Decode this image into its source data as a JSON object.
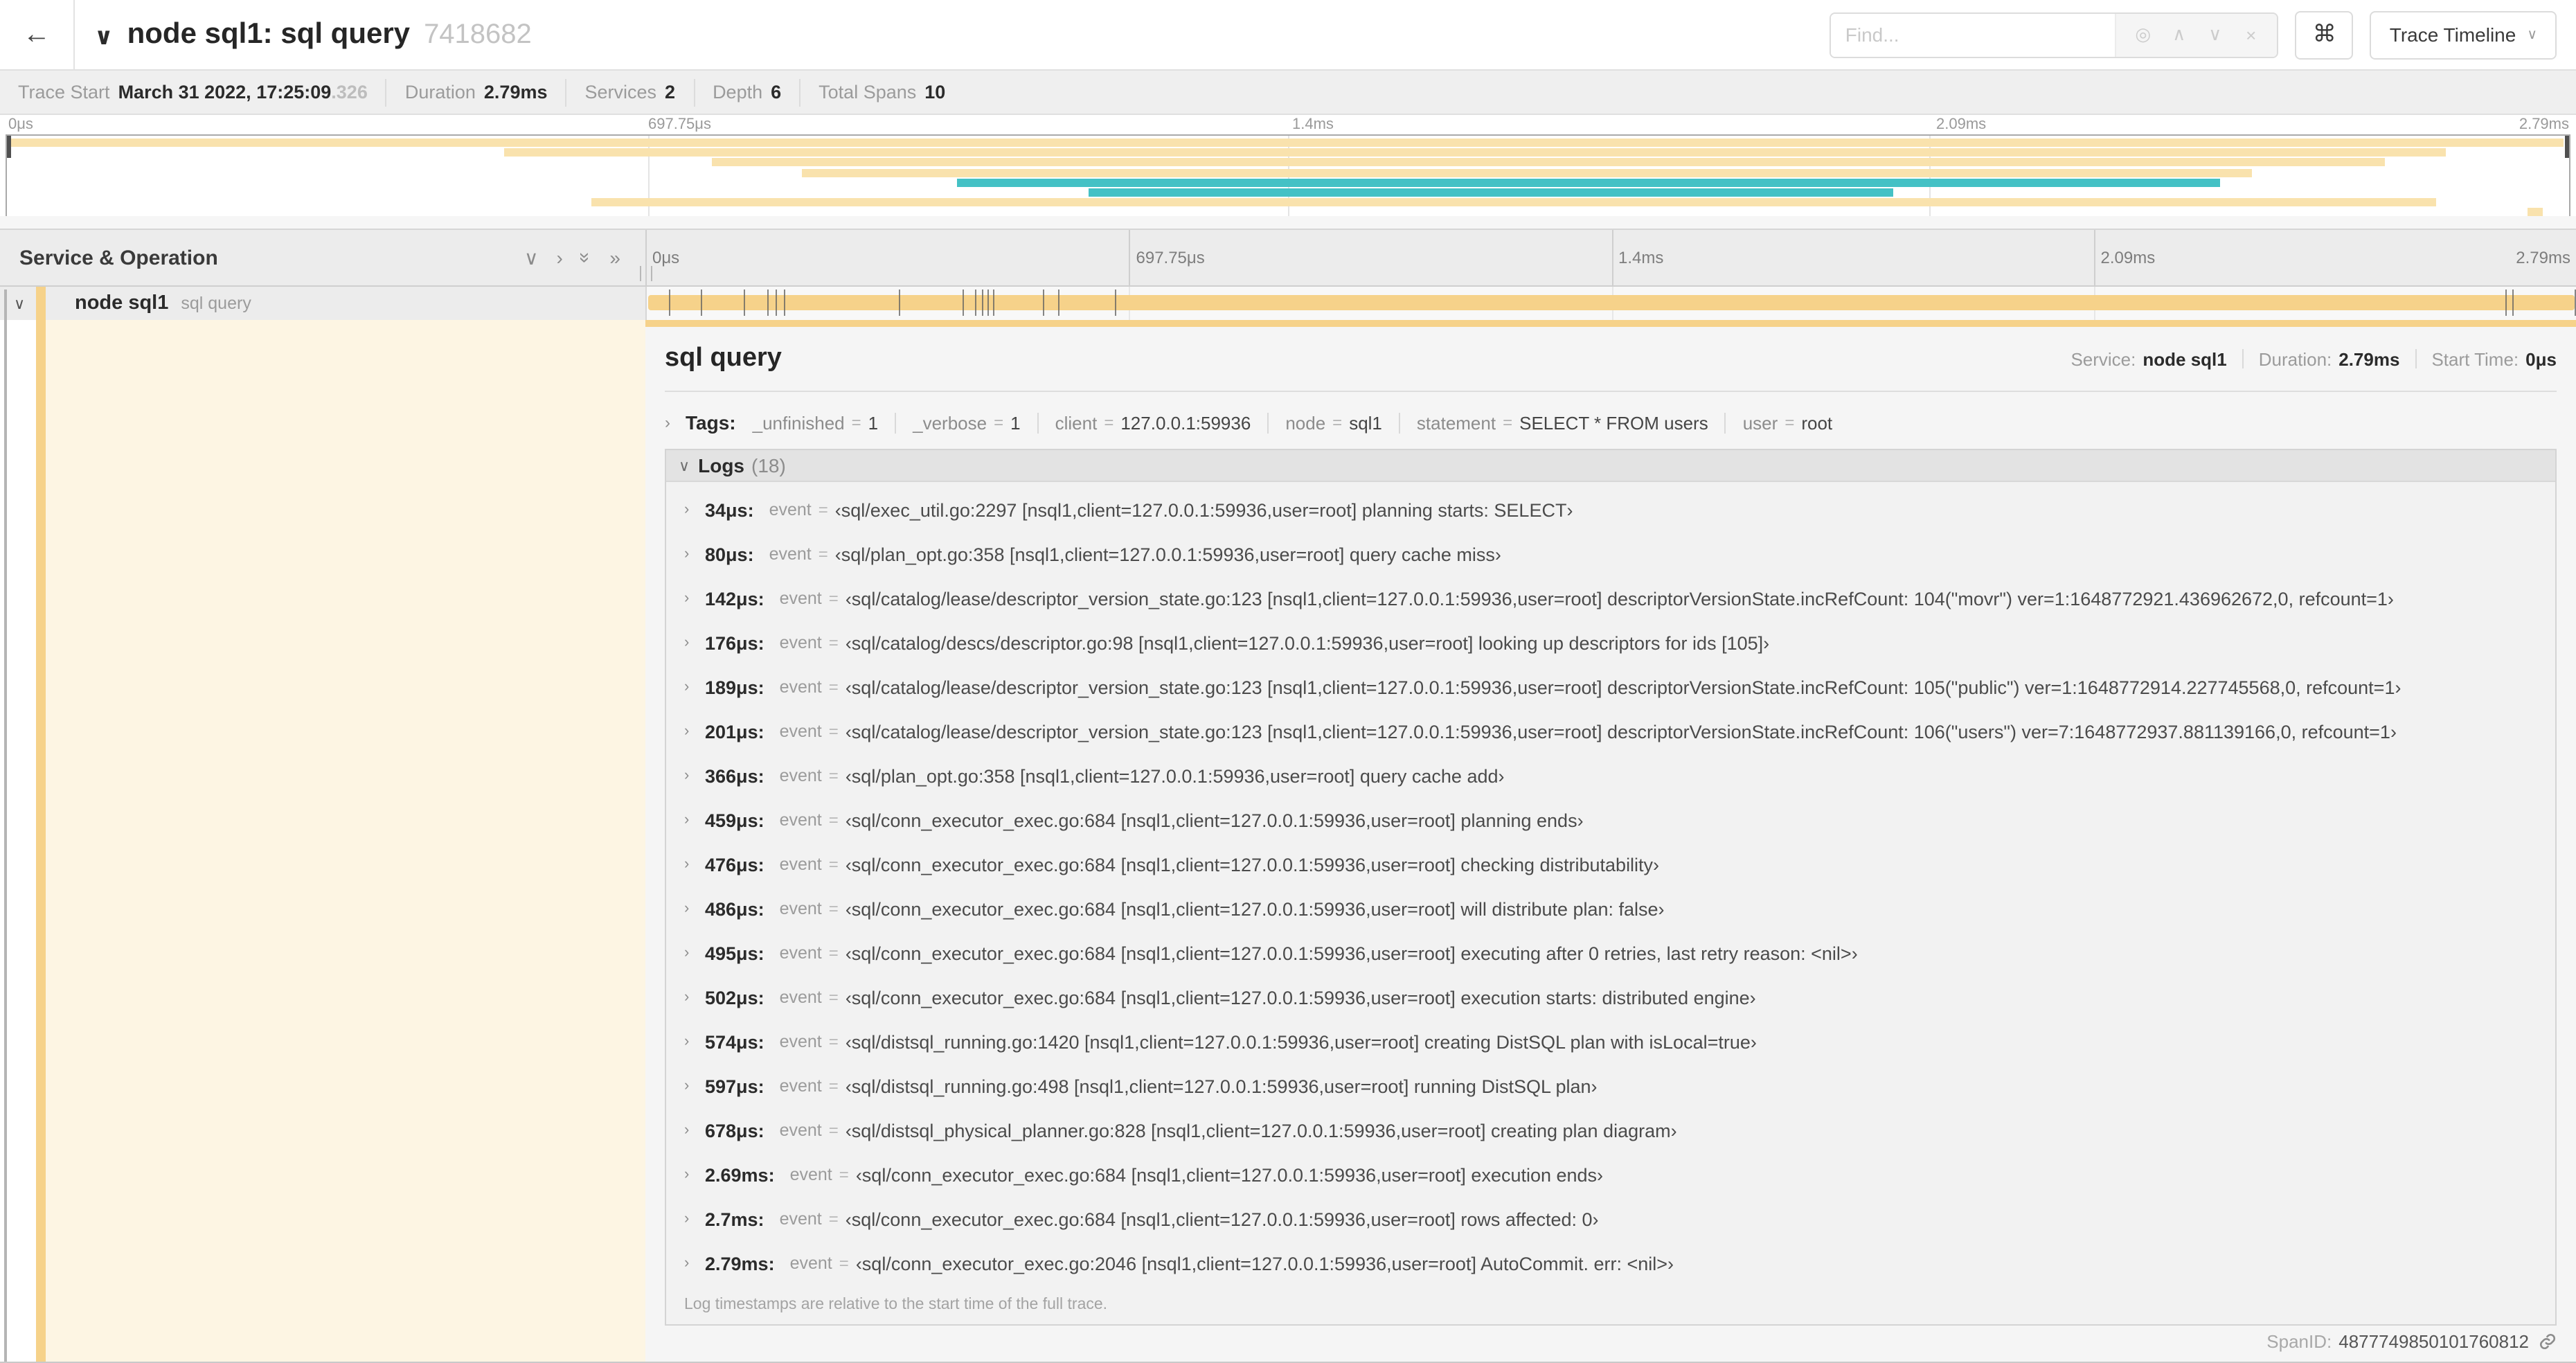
{
  "icons": {
    "back_arrow": "←",
    "chevron_down": "∨",
    "chevron_right": "›",
    "double_chevron": "»",
    "target": "◎",
    "up": "∧",
    "down": "∨",
    "close": "×",
    "command": "⌘",
    "caret_down": "∨"
  },
  "header": {
    "title": "node sql1: sql query",
    "trace_id": "7418682",
    "find_placeholder": "Find...",
    "view_button": "Trace Timeline"
  },
  "trace_info": [
    {
      "label": "Trace Start",
      "value": "March 31 2022, 17:25:09",
      "suffix": ".326"
    },
    {
      "label": "Duration",
      "value": "2.79ms"
    },
    {
      "label": "Services",
      "value": "2"
    },
    {
      "label": "Depth",
      "value": "6"
    },
    {
      "label": "Total Spans",
      "value": "10"
    }
  ],
  "timeline": {
    "ticks": [
      {
        "label": "0μs",
        "pct": 0
      },
      {
        "label": "697.75μs",
        "pct": 25
      },
      {
        "label": "1.4ms",
        "pct": 50
      },
      {
        "label": "2.09ms",
        "pct": 75
      },
      {
        "label": "2.79ms",
        "pct": 100
      }
    ],
    "total_us": 2790
  },
  "minimap": {
    "rows": [
      {
        "start": 0,
        "end": 99.8,
        "color": "yellow"
      },
      {
        "start": 19.4,
        "end": 95.2,
        "color": "yellow"
      },
      {
        "start": 27.5,
        "end": 92.8,
        "color": "yellow"
      },
      {
        "start": 31.0,
        "end": 87.6,
        "color": "yellow"
      },
      {
        "start": 37.1,
        "end": 86.4,
        "color": "teal"
      },
      {
        "start": 42.2,
        "end": 73.6,
        "color": "teal"
      },
      {
        "start": 22.8,
        "end": 94.8,
        "color": "yellow"
      },
      {
        "start": 98.4,
        "end": 99.0,
        "color": "yellow"
      }
    ]
  },
  "left_panel": {
    "title": "Service & Operation"
  },
  "span_row": {
    "service": "node sql1",
    "operation": "sql query"
  },
  "detail": {
    "title": "sql query",
    "stats": [
      {
        "label": "Service:",
        "value": "node sql1"
      },
      {
        "label": "Duration:",
        "value": "2.79ms"
      },
      {
        "label": "Start Time:",
        "value": "0μs"
      }
    ],
    "tags_label": "Tags:",
    "tags": [
      {
        "key": "_unfinished",
        "value": "1"
      },
      {
        "key": "_verbose",
        "value": "1"
      },
      {
        "key": "client",
        "value": "127.0.0.1:59936"
      },
      {
        "key": "node",
        "value": "sql1"
      },
      {
        "key": "statement",
        "value": "SELECT * FROM users"
      },
      {
        "key": "user",
        "value": "root"
      }
    ],
    "logs_label": "Logs",
    "logs_count": "(18)",
    "logs_key": "event",
    "logs": [
      {
        "time": "34μs:",
        "t_us": 34,
        "value": "‹sql/exec_util.go:2297 [nsql1,client=127.0.0.1:59936,user=root] planning starts: SELECT›"
      },
      {
        "time": "80μs:",
        "t_us": 80,
        "value": "‹sql/plan_opt.go:358 [nsql1,client=127.0.0.1:59936,user=root] query cache miss›"
      },
      {
        "time": "142μs:",
        "t_us": 142,
        "value": "‹sql/catalog/lease/descriptor_version_state.go:123 [nsql1,client=127.0.0.1:59936,user=root] descriptorVersionState.incRefCount: 104(\"movr\") ver=1:1648772921.436962672,0, refcount=1›"
      },
      {
        "time": "176μs:",
        "t_us": 176,
        "value": "‹sql/catalog/descs/descriptor.go:98 [nsql1,client=127.0.0.1:59936,user=root] looking up descriptors for ids [105]›"
      },
      {
        "time": "189μs:",
        "t_us": 189,
        "value": "‹sql/catalog/lease/descriptor_version_state.go:123 [nsql1,client=127.0.0.1:59936,user=root] descriptorVersionState.incRefCount: 105(\"public\") ver=1:1648772914.227745568,0, refcount=1›"
      },
      {
        "time": "201μs:",
        "t_us": 201,
        "value": "‹sql/catalog/lease/descriptor_version_state.go:123 [nsql1,client=127.0.0.1:59936,user=root] descriptorVersionState.incRefCount: 106(\"users\") ver=7:1648772937.881139166,0, refcount=1›"
      },
      {
        "time": "366μs:",
        "t_us": 366,
        "value": "‹sql/plan_opt.go:358 [nsql1,client=127.0.0.1:59936,user=root] query cache add›"
      },
      {
        "time": "459μs:",
        "t_us": 459,
        "value": "‹sql/conn_executor_exec.go:684 [nsql1,client=127.0.0.1:59936,user=root] planning ends›"
      },
      {
        "time": "476μs:",
        "t_us": 476,
        "value": "‹sql/conn_executor_exec.go:684 [nsql1,client=127.0.0.1:59936,user=root] checking distributability›"
      },
      {
        "time": "486μs:",
        "t_us": 486,
        "value": "‹sql/conn_executor_exec.go:684 [nsql1,client=127.0.0.1:59936,user=root] will distribute plan: false›"
      },
      {
        "time": "495μs:",
        "t_us": 495,
        "value": "‹sql/conn_executor_exec.go:684 [nsql1,client=127.0.0.1:59936,user=root] executing after 0 retries, last retry reason: <nil>›"
      },
      {
        "time": "502μs:",
        "t_us": 502,
        "value": "‹sql/conn_executor_exec.go:684 [nsql1,client=127.0.0.1:59936,user=root] execution starts: distributed engine›"
      },
      {
        "time": "574μs:",
        "t_us": 574,
        "value": "‹sql/distsql_running.go:1420 [nsql1,client=127.0.0.1:59936,user=root] creating DistSQL plan with isLocal=true›"
      },
      {
        "time": "597μs:",
        "t_us": 597,
        "value": "‹sql/distsql_running.go:498 [nsql1,client=127.0.0.1:59936,user=root] running DistSQL plan›"
      },
      {
        "time": "678μs:",
        "t_us": 678,
        "value": "‹sql/distsql_physical_planner.go:828 [nsql1,client=127.0.0.1:59936,user=root] creating plan diagram›"
      },
      {
        "time": "2.69ms:",
        "t_us": 2690,
        "value": "‹sql/conn_executor_exec.go:684 [nsql1,client=127.0.0.1:59936,user=root] execution ends›"
      },
      {
        "time": "2.7ms:",
        "t_us": 2700,
        "value": "‹sql/conn_executor_exec.go:684 [nsql1,client=127.0.0.1:59936,user=root] rows affected: 0›"
      },
      {
        "time": "2.79ms:",
        "t_us": 2790,
        "value": "‹sql/conn_executor_exec.go:2046 [nsql1,client=127.0.0.1:59936,user=root] AutoCommit. err: <nil>›"
      }
    ],
    "logs_note": "Log timestamps are relative to the start time of the full trace.",
    "span_id_label": "SpanID:",
    "span_id": "4877749850101760812"
  },
  "colors": {
    "span_yellow": "#f6d28a",
    "minimap_yellow": "#f9e2ad",
    "teal": "#44c1c5",
    "left_tint": "#fdf5e3"
  }
}
